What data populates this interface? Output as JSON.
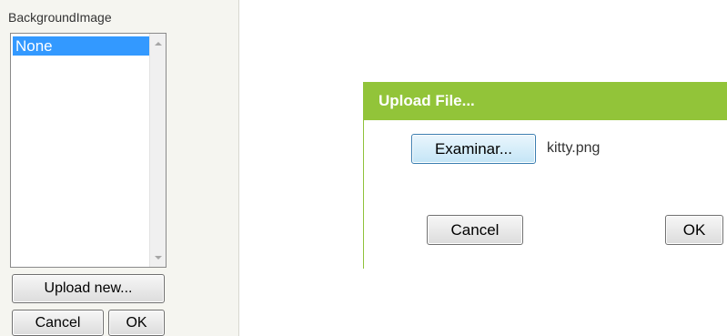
{
  "background_panel": {
    "title": "BackgroundImage",
    "list_items": [
      "None"
    ],
    "selected_item": "None",
    "upload_new_label": "Upload new...",
    "cancel_label": "Cancel",
    "ok_label": "OK"
  },
  "upload_dialog": {
    "title": "Upload File...",
    "browse_label": "Examinar...",
    "file_name": "kitty.png",
    "cancel_label": "Cancel",
    "ok_label": "OK",
    "header_color": "#92c439"
  },
  "colors": {
    "selection": "#3399ff",
    "panel_background": "#f5f5f0"
  }
}
